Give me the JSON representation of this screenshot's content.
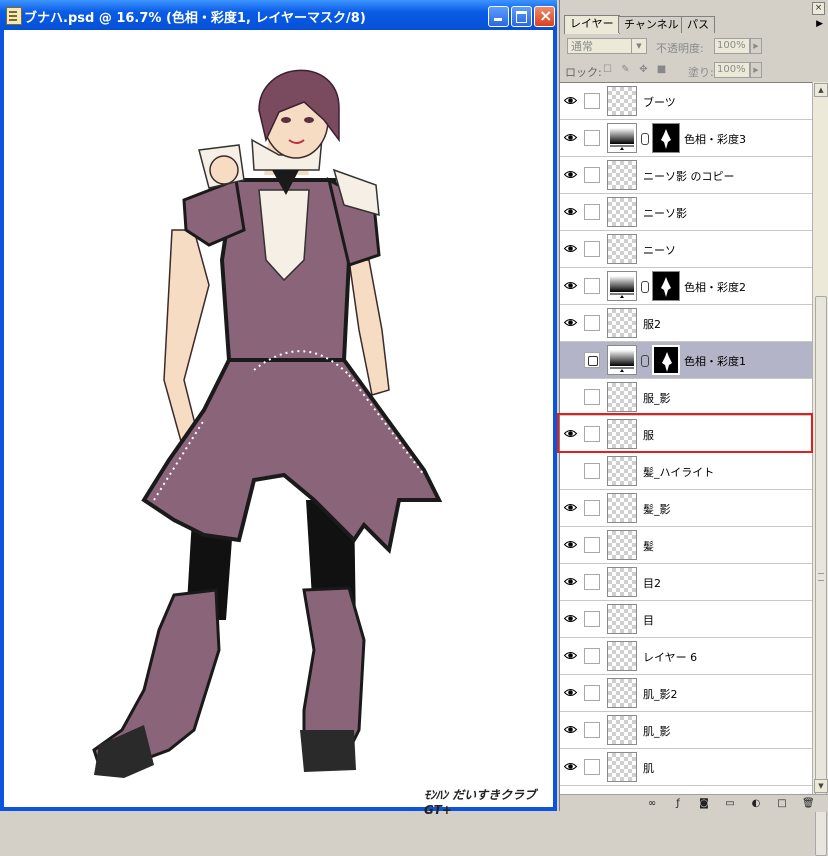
{
  "document": {
    "title": "ブナハ.psd @ 16.7% (色相・彩度1, レイヤーマスク/8)",
    "watermark": "ﾓﾝﾊﾝ だいすきクラブGT+"
  },
  "window_buttons": {
    "minimize": "_",
    "maximize": "□",
    "close": "×"
  },
  "panel": {
    "close": "×",
    "tabs": [
      {
        "label": "レイヤー",
        "active": true
      },
      {
        "label": "チャンネル",
        "active": false
      },
      {
        "label": "パス",
        "active": false
      }
    ],
    "menu_icon": "▶",
    "blend_mode": "通常",
    "opacity_label": "不透明度:",
    "opacity_value": "100%",
    "lock_label": "ロック:",
    "fill_label": "塗り:",
    "fill_value": "100%",
    "arrow": "▶",
    "dropdown_arrow": "▼",
    "lock_icons": [
      "☐",
      "✎",
      "✥",
      "■"
    ]
  },
  "layers": [
    {
      "name": "ブーツ",
      "visible": true,
      "type": "pixel"
    },
    {
      "name": "色相・彩度3",
      "visible": true,
      "type": "adjustment"
    },
    {
      "name": "ニーソ影 のコピー",
      "visible": true,
      "type": "pixel"
    },
    {
      "name": "ニーソ影",
      "visible": true,
      "type": "pixel"
    },
    {
      "name": "ニーソ",
      "visible": true,
      "type": "pixel"
    },
    {
      "name": "色相・彩度2",
      "visible": true,
      "type": "adjustment"
    },
    {
      "name": "服2",
      "visible": true,
      "type": "pixel"
    },
    {
      "name": "色相・彩度1",
      "visible": false,
      "type": "adjustment",
      "selected": true
    },
    {
      "name": "服_影",
      "visible": false,
      "type": "pixel"
    },
    {
      "name": "服",
      "visible": true,
      "type": "pixel"
    },
    {
      "name": "髪_ハイライト",
      "visible": false,
      "type": "pixel"
    },
    {
      "name": "髪_影",
      "visible": true,
      "type": "pixel"
    },
    {
      "name": "髪",
      "visible": true,
      "type": "pixel"
    },
    {
      "name": "目2",
      "visible": true,
      "type": "pixel"
    },
    {
      "name": "目",
      "visible": true,
      "type": "pixel"
    },
    {
      "name": "レイヤー 6",
      "visible": true,
      "type": "pixel"
    },
    {
      "name": "肌_影2",
      "visible": true,
      "type": "pixel"
    },
    {
      "name": "肌_影",
      "visible": true,
      "type": "pixel"
    },
    {
      "name": "肌",
      "visible": true,
      "type": "pixel"
    }
  ],
  "scrollbar": {
    "up": "▲",
    "down": "▼"
  },
  "bottom_icons": [
    "link-layers-icon",
    "layer-style-icon",
    "add-mask-icon",
    "new-group-icon",
    "new-adjustment-icon",
    "new-layer-icon",
    "delete-layer-icon"
  ],
  "colors": {
    "dress": "#8a6478",
    "highlight_box": "#e02020",
    "selected_row": "#b4b4c8"
  }
}
